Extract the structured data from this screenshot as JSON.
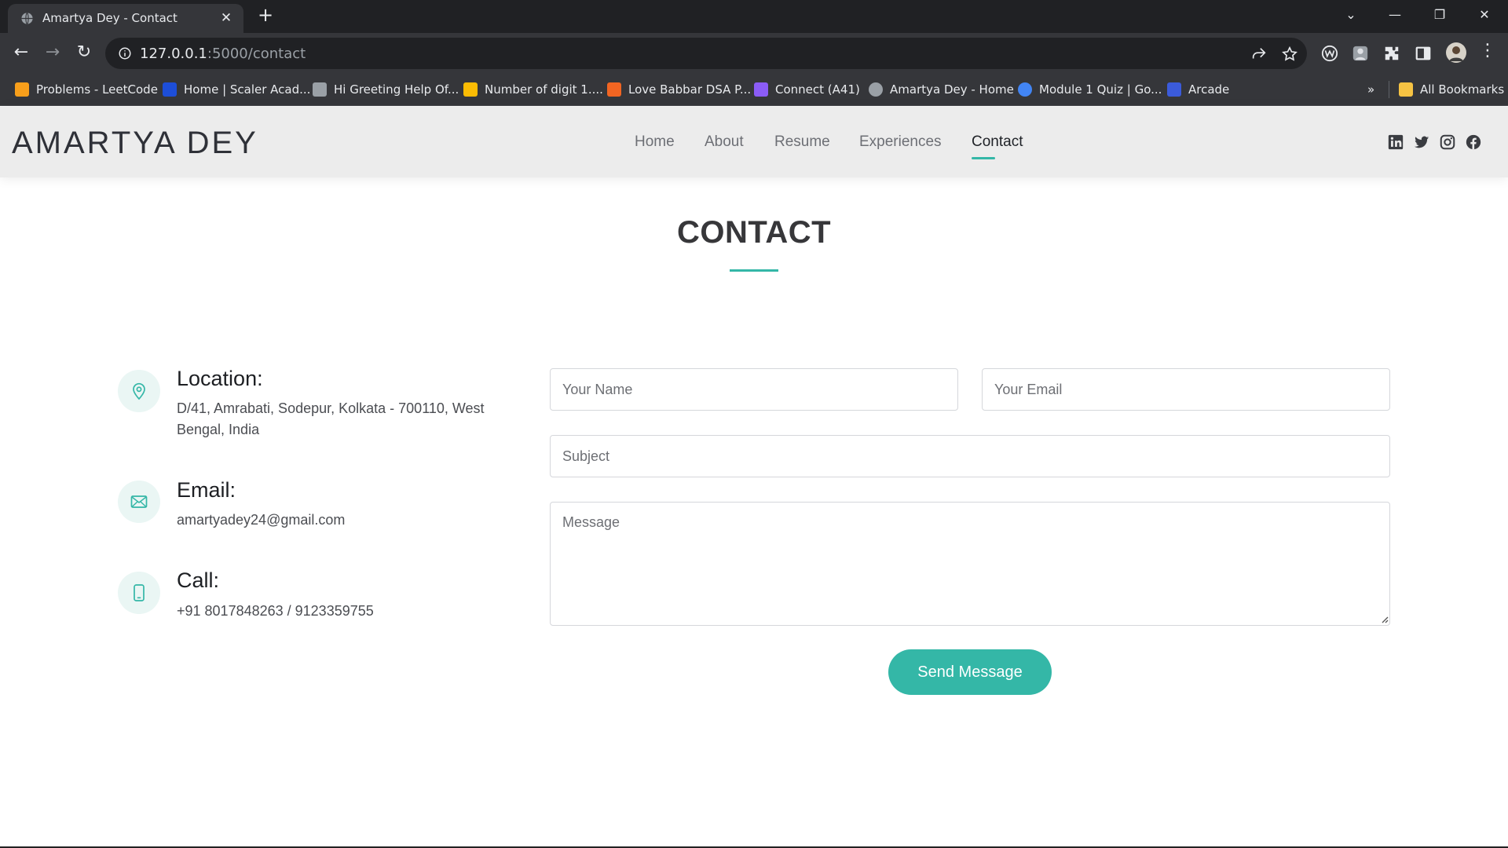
{
  "browser": {
    "tab_title": "Amartya Dey - Contact",
    "tab_close": "✕",
    "new_tab": "+",
    "url_host": "127.0.0.1",
    "url_path": ":5000/contact",
    "controls": {
      "dropdown": "⌄",
      "minimize": "—",
      "restore": "❐",
      "close": "✕"
    },
    "nav": {
      "back": "←",
      "forward": "→",
      "reload": "↻",
      "more": "⋮"
    },
    "bookmarks": [
      {
        "label": "Problems - LeetCode",
        "color": "#f89f1b"
      },
      {
        "label": "Home | Scaler Acad...",
        "color": "#1d4ed8"
      },
      {
        "label": "Hi Greeting Help Of...",
        "color": "#9aa0a6"
      },
      {
        "label": "Number of digit 1....",
        "color": "#fbbc04"
      },
      {
        "label": "Love Babbar DSA P...",
        "color": "#f26522"
      },
      {
        "label": "Connect (A41)",
        "color": "#8b5cf6"
      },
      {
        "label": "Amartya Dey - Home",
        "color": "#9aa0a6"
      },
      {
        "label": "Module 1 Quiz | Go...",
        "color": "#4285f4"
      },
      {
        "label": "Arcade",
        "color": "#3b5bdb"
      }
    ],
    "bookmarks_overflow": "»",
    "all_bookmarks": "All Bookmarks"
  },
  "site": {
    "logo": "AMARTYA DEY",
    "nav": [
      "Home",
      "About",
      "Resume",
      "Experiences",
      "Contact"
    ],
    "active_nav": "Contact",
    "accent_color": "#34b7a7",
    "social_icons": [
      "linkedin-icon",
      "twitter-icon",
      "instagram-icon",
      "facebook-icon"
    ]
  },
  "contact": {
    "title": "CONTACT",
    "location_label": "Location:",
    "location_value": "D/41, Amrabati, Sodepur, Kolkata - 700110, West Bengal, India",
    "email_label": "Email:",
    "email_value": "amartyadey24@gmail.com",
    "call_label": "Call:",
    "call_value": "+91 8017848263 / 9123359755",
    "form": {
      "name_placeholder": "Your Name",
      "email_placeholder": "Your Email",
      "subject_placeholder": "Subject",
      "message_placeholder": "Message",
      "submit_label": "Send Message"
    }
  }
}
